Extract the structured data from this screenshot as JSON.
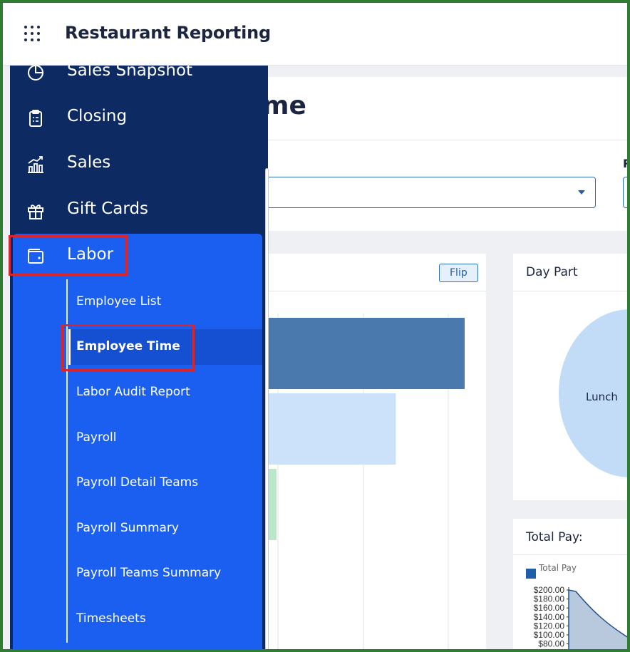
{
  "header": {
    "app_title": "Restaurant Reporting",
    "apps_icon": "apps-grid-icon"
  },
  "sidebar": {
    "items": [
      {
        "label": "Sales Snapshot",
        "icon": "pie-chart-icon"
      },
      {
        "label": "Closing",
        "icon": "clipboard-icon"
      },
      {
        "label": "Sales",
        "icon": "bar-chart-trend-icon"
      },
      {
        "label": "Gift Cards",
        "icon": "gift-icon"
      },
      {
        "label": "Labor",
        "icon": "wallet-icon"
      }
    ],
    "labor_submenu": [
      {
        "label": "Employee List"
      },
      {
        "label": "Employee Time",
        "active": true
      },
      {
        "label": "Labor Audit Report"
      },
      {
        "label": "Payroll"
      },
      {
        "label": "Payroll Detail Teams"
      },
      {
        "label": "Payroll Summary"
      },
      {
        "label": "Payroll Teams Summary"
      },
      {
        "label": "Timesheets"
      }
    ]
  },
  "main": {
    "page_title_visible": "me",
    "filter_label_visible": "R",
    "flip_label": "Flip",
    "day_part": {
      "title": "Day Part",
      "slice_label": "Lunch"
    },
    "total_pay": {
      "title": "Total Pay:",
      "legend": "Total Pay"
    }
  },
  "colors": {
    "sidebar_bg": "#0d2a62",
    "labor_section_bg": "#1a5ff0",
    "highlight": "#d9252c",
    "frame": "#2e7d32",
    "bar_dark": "#4a7aad",
    "bar_light": "#cce2fb",
    "bar_green": "#b8e8c8"
  },
  "chart_data": [
    {
      "type": "bar",
      "orientation": "horizontal",
      "values": [
        1.0,
        0.65,
        0.0
      ]
    },
    {
      "type": "pie",
      "categories": [
        "Lunch"
      ]
    },
    {
      "type": "area",
      "series": [
        {
          "name": "Total Pay"
        }
      ],
      "y_tick_labels": [
        "$200.00",
        "$180.00",
        "$160.00",
        "$140.00",
        "$120.00",
        "$100.00",
        "$80.00"
      ]
    }
  ]
}
